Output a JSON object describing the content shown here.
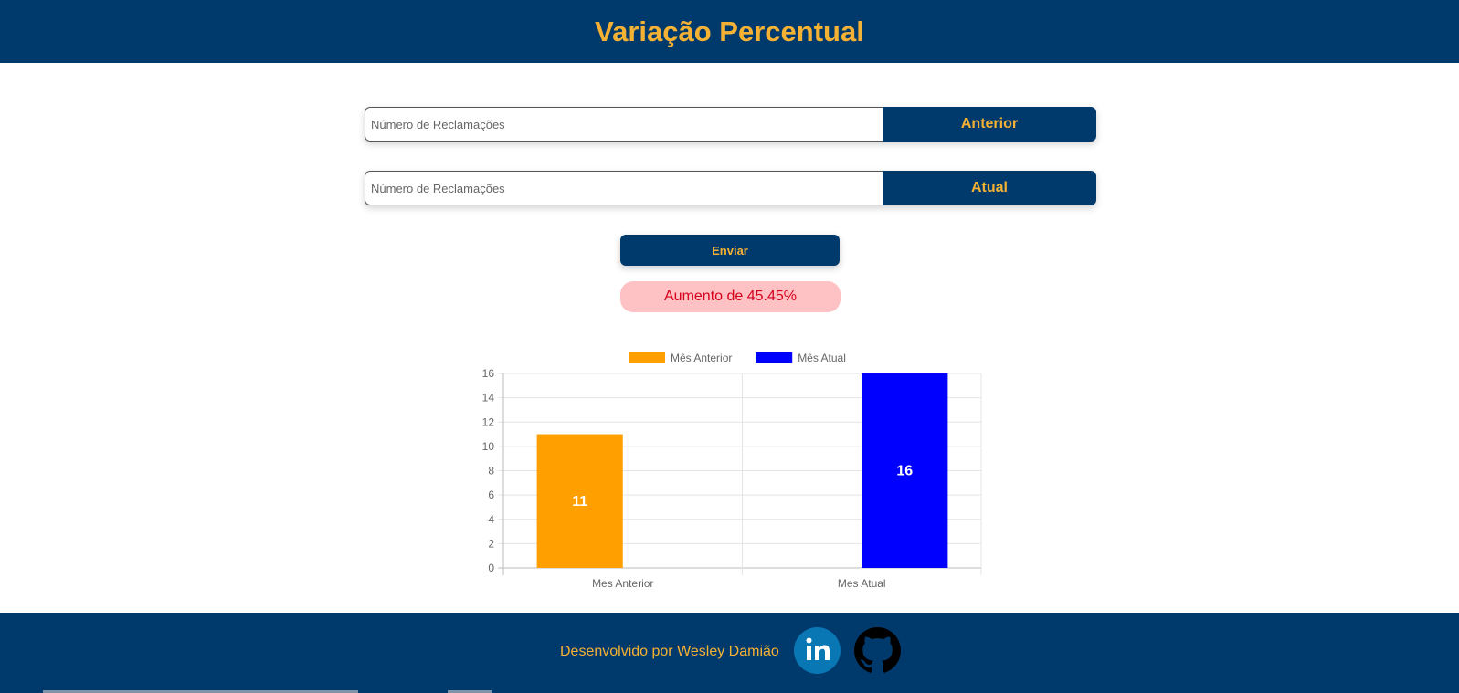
{
  "header": {
    "title": "Variação Percentual"
  },
  "form": {
    "previous": {
      "placeholder": "Número de Reclamações",
      "label": "Anterior"
    },
    "current": {
      "placeholder": "Número de Reclamações",
      "label": "Atual"
    },
    "submit_label": "Enviar"
  },
  "result": {
    "text": "Aumento de 45.45%"
  },
  "chart_data": {
    "type": "bar",
    "categories": [
      "Mes Anterior",
      "Mes Atual"
    ],
    "series": [
      {
        "name": "Mês Anterior",
        "color": "#ff9f00",
        "values": [
          11,
          null
        ]
      },
      {
        "name": "Mês Atual",
        "color": "#0000ff",
        "values": [
          null,
          16
        ]
      }
    ],
    "values": [
      11,
      16
    ],
    "data_labels": [
      "11",
      "16"
    ],
    "ylim": [
      0,
      16
    ],
    "yticks": [
      "0",
      "2",
      "4",
      "6",
      "8",
      "10",
      "12",
      "14",
      "16"
    ],
    "legend": "top",
    "grid": true
  },
  "footer": {
    "credit": "Desenvolvido por Wesley Damião",
    "icons": [
      "linkedin-icon",
      "github-icon"
    ]
  },
  "colors": {
    "navy": "#003a6c",
    "accent": "#f5b133",
    "danger_bg": "#ffc2c4",
    "danger_text": "#d5001c"
  }
}
